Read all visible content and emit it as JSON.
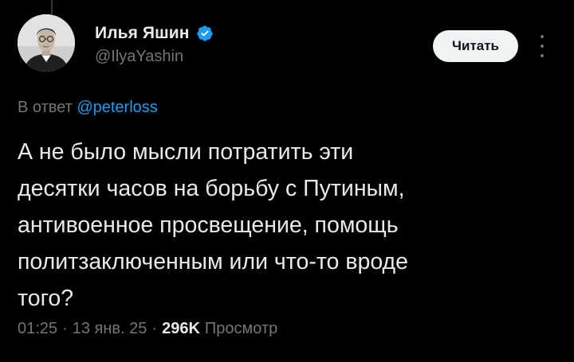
{
  "tweet": {
    "author": {
      "display_name": "Илья Яшин",
      "handle": "@IlyaYashin",
      "verified": true,
      "avatar_icon": "avatar-photo"
    },
    "follow_label": "Читать",
    "reply_prefix": "В ответ",
    "reply_mention": "@peterloss",
    "text": "А не было мысли потратить эти\nдесятки часов на борьбу с Путиным,\nантивоенное просвещение, помощь\nполитзаключенным или что-то вроде\nтого?",
    "time": "01:25",
    "separator": "·",
    "date": "13 янв. 25",
    "views_count": "296K",
    "views_label": "Просмотр"
  },
  "colors": {
    "background": "#000000",
    "primary_text": "#e7e9ea",
    "secondary_text": "#71767b",
    "accent": "#1d9bf0",
    "button_bg": "#eff3f4"
  }
}
